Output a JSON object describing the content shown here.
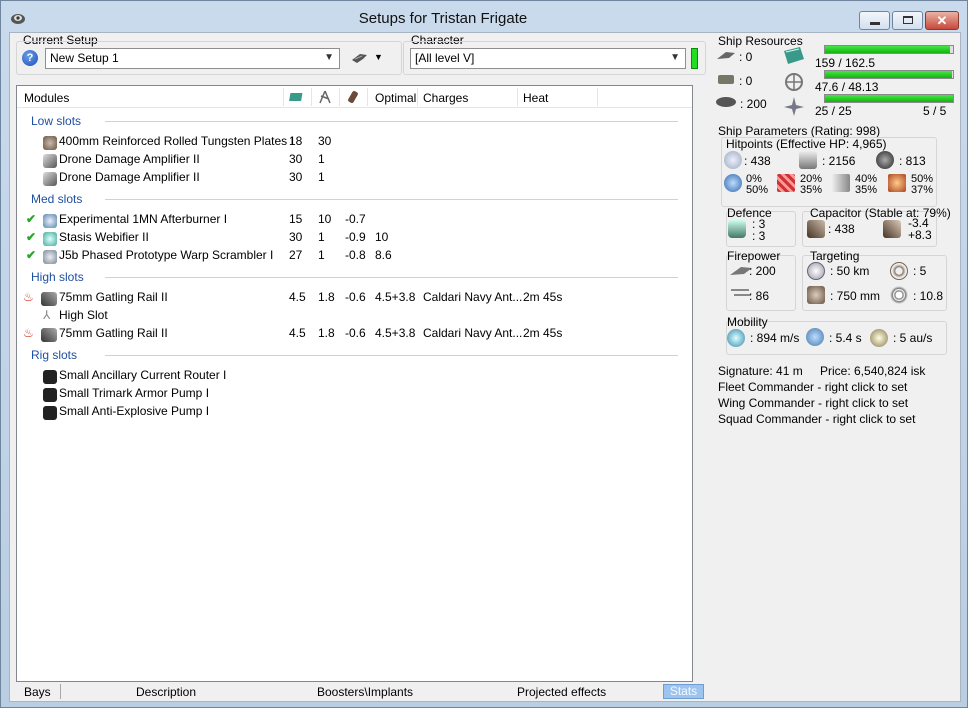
{
  "window": {
    "title": "Setups for Tristan Frigate"
  },
  "setup": {
    "label": "Current Setup",
    "value": "New Setup 1"
  },
  "character": {
    "label": "Character",
    "value": "[All level V]"
  },
  "columns": {
    "modules": "Modules",
    "optimal": "Optimal",
    "charges": "Charges",
    "heat": "Heat"
  },
  "sections": {
    "low": {
      "title": "Low slots",
      "rows": [
        {
          "name": "400mm Reinforced Rolled Tungsten Plates I",
          "c1": "18",
          "c2": "30",
          "c3": "",
          "optimal": "",
          "charges": "",
          "heat": ""
        },
        {
          "name": "Drone Damage Amplifier II",
          "c1": "30",
          "c2": "1",
          "c3": "",
          "optimal": "",
          "charges": "",
          "heat": ""
        },
        {
          "name": "Drone Damage Amplifier II",
          "c1": "30",
          "c2": "1",
          "c3": "",
          "optimal": "",
          "charges": "",
          "heat": ""
        }
      ]
    },
    "med": {
      "title": "Med slots",
      "rows": [
        {
          "name": "Experimental 1MN Afterburner I",
          "c1": "15",
          "c2": "10",
          "c3": "-0.7",
          "optimal": "",
          "charges": "",
          "heat": ""
        },
        {
          "name": "Stasis Webifier II",
          "c1": "30",
          "c2": "1",
          "c3": "-0.9",
          "optimal": "10",
          "charges": "",
          "heat": ""
        },
        {
          "name": "J5b Phased Prototype Warp Scrambler I",
          "c1": "27",
          "c2": "1",
          "c3": "-0.8",
          "optimal": "8.6",
          "charges": "",
          "heat": ""
        }
      ]
    },
    "high": {
      "title": "High slots",
      "rows": [
        {
          "name": "75mm Gatling Rail II",
          "c1": "4.5",
          "c2": "1.8",
          "c3": "-0.6",
          "optimal": "4.5+3.8",
          "charges": "Caldari Navy Ant...",
          "heat": "2m 45s"
        },
        {
          "name": "High Slot",
          "c1": "",
          "c2": "",
          "c3": "",
          "optimal": "",
          "charges": "",
          "heat": ""
        },
        {
          "name": "75mm Gatling Rail II",
          "c1": "4.5",
          "c2": "1.8",
          "c3": "-0.6",
          "optimal": "4.5+3.8",
          "charges": "Caldari Navy Ant...",
          "heat": "2m 45s"
        }
      ]
    },
    "rig": {
      "title": "Rig slots",
      "rows": [
        {
          "name": "Small Ancillary Current Router I"
        },
        {
          "name": "Small Trimark Armor Pump I"
        },
        {
          "name": "Small Anti-Explosive Pump I"
        }
      ]
    }
  },
  "tabs": {
    "bays": "Bays",
    "description": "Description",
    "boosters": "Boosters\\Implants",
    "projected": "Projected effects",
    "stats": "Stats"
  },
  "resources": {
    "title": "Ship Resources",
    "turret": ": 0",
    "launcher": ": 0",
    "drone_bw": ": 200",
    "cpu": "159 / 162.5",
    "cpu_fraction": 0.978,
    "pg": "47.6 / 48.13",
    "pg_fraction": 0.989,
    "drones": "25 / 25",
    "drones_fraction": 1.0,
    "drones_active": "5 / 5"
  },
  "params": {
    "title": "Ship Parameters (Rating: 998)",
    "hitpoints": {
      "label": "Hitpoints (Effective HP: 4,965)",
      "shield": ": 438",
      "armor": ": 2156",
      "structure": ": 813",
      "em": [
        "0%",
        "50%"
      ],
      "thermal": [
        "20%",
        "35%"
      ],
      "kinetic": [
        "40%",
        "35%"
      ],
      "explosive": [
        "50%",
        "37%"
      ]
    },
    "defence": {
      "label": "Defence",
      "top": ": 3",
      "bottom": ": 3"
    },
    "capacitor": {
      "label": "Capacitor (Stable at: 79%)",
      "value": ": 438",
      "delta_top": "-3.4",
      "delta_bottom": "+8.3"
    },
    "firepower": {
      "label": "Firepower",
      "dps": ": 200",
      "volley": ": 86"
    },
    "targeting": {
      "label": "Targeting",
      "range": ": 50 km",
      "max_targets": ": 5",
      "sig_res": ": 750 mm",
      "scan": ": 10.8"
    },
    "mobility": {
      "label": "Mobility",
      "speed": ": 894 m/s",
      "align": ": 5.4 s",
      "warp": ": 5 au/s"
    },
    "signature": "Signature: 41 m",
    "price": "Price: 6,540,824 isk",
    "fleet": "Fleet Commander - right click to set",
    "wing": "Wing Commander - right click to set",
    "squad": "Squad Commander - right click to set"
  },
  "colors": {
    "accent": "#1f4fa0",
    "bar_fill": "#22cc22",
    "selected_tab": "#9dc4ef"
  }
}
